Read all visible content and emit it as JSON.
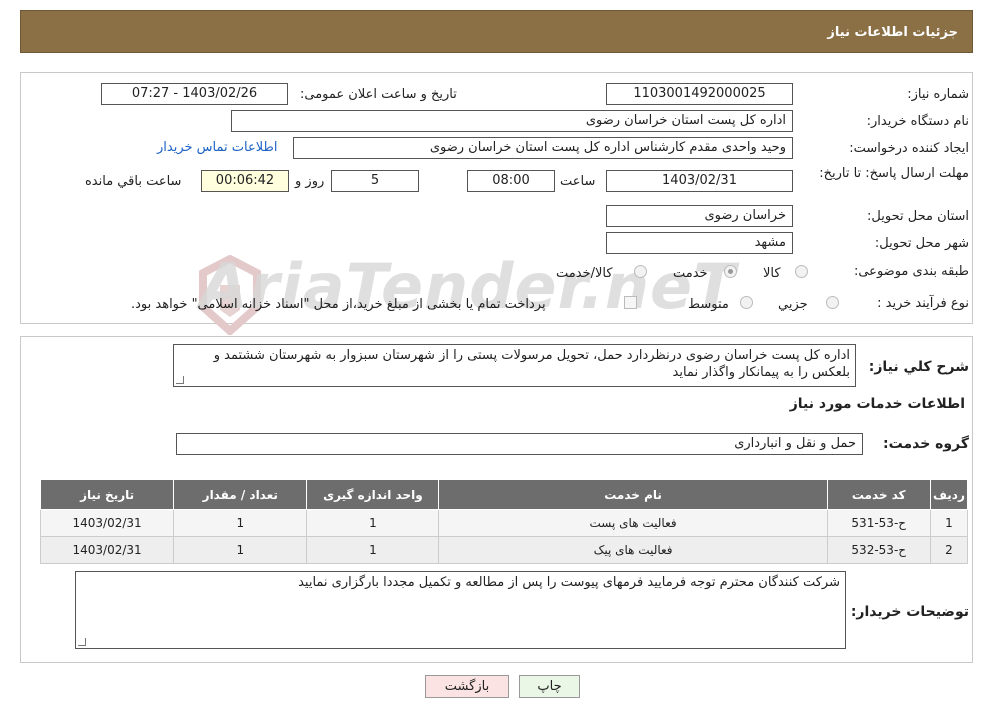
{
  "header": {
    "title": "جزئیات اطلاعات نیاز"
  },
  "watermark": {
    "text": "AriaTender.neT"
  },
  "info": {
    "need_number_label": "شماره نیاز:",
    "need_number": "1103001492000025",
    "announce_label": "تاریخ و ساعت اعلان عمومی:",
    "announce_value": "1403/02/26 - 07:27",
    "buyer_org_label": "نام دستگاه خریدار:",
    "buyer_org": "اداره کل پست استان خراسان رضوی",
    "requester_label": "ایجاد کننده درخواست:",
    "requester": "وحید واحدی مقدم کارشناس اداره کل پست استان خراسان رضوی",
    "contact_link": "اطلاعات تماس خریدار",
    "deadline_label": "مهلت ارسال پاسخ: تا تاریخ:",
    "deadline_date": "1403/02/31",
    "time_label": "ساعت",
    "deadline_time": "08:00",
    "days_value": "5",
    "days_label": "روز و",
    "remaining_time": "00:06:42",
    "remaining_label": "ساعت باقي مانده",
    "province_label": "استان محل تحویل:",
    "province": "خراسان رضوی",
    "city_label": "شهر محل تحویل:",
    "city": "مشهد",
    "category_label": "طبقه بندی موضوعی:",
    "category_options": [
      "کالا",
      "خدمت",
      "کالا/خدمت"
    ],
    "category_selected": "خدمت",
    "process_label": "نوع فرآیند خرید :",
    "process_options": [
      "جزیي",
      "متوسط"
    ],
    "payment_note": "پرداخت تمام یا بخشی از مبلغ خرید،از محل \"اسناد خزانه اسلامی\" خواهد بود."
  },
  "details": {
    "summary_label": "شرح کلي نياز:",
    "summary_text": "اداره کل پست خراسان رضوی درنظردارد حمل، تحویل مرسولات پستی را از شهرستان سبزوار به شهرستان ششتمد و بلعکس را به پیمانکار واگذار نماید",
    "services_title": "اطلاعات خدمات مورد نياز",
    "group_label": "گروه خدمت:",
    "group_value": "حمل و نقل و انبارداری",
    "table": {
      "headers": [
        "ردیف",
        "کد خدمت",
        "نام خدمت",
        "واحد اندازه گیری",
        "تعداد / مقدار",
        "تاریخ نیاز"
      ],
      "rows": [
        [
          "1",
          "ح-53-531",
          "فعالیت های پست",
          "1",
          "1",
          "1403/02/31"
        ],
        [
          "2",
          "ح-53-532",
          "فعالیت های پیک",
          "1",
          "1",
          "1403/02/31"
        ]
      ]
    },
    "buyer_notes_label": "توضیحات خریدار:",
    "buyer_notes": "شرکت کنندگان محترم توجه فرمایید فرمهای پیوست را پس از مطالعه و تکمیل مجددا بارگزاری نمایید"
  },
  "buttons": {
    "print": "چاپ",
    "back": "بازگشت"
  }
}
